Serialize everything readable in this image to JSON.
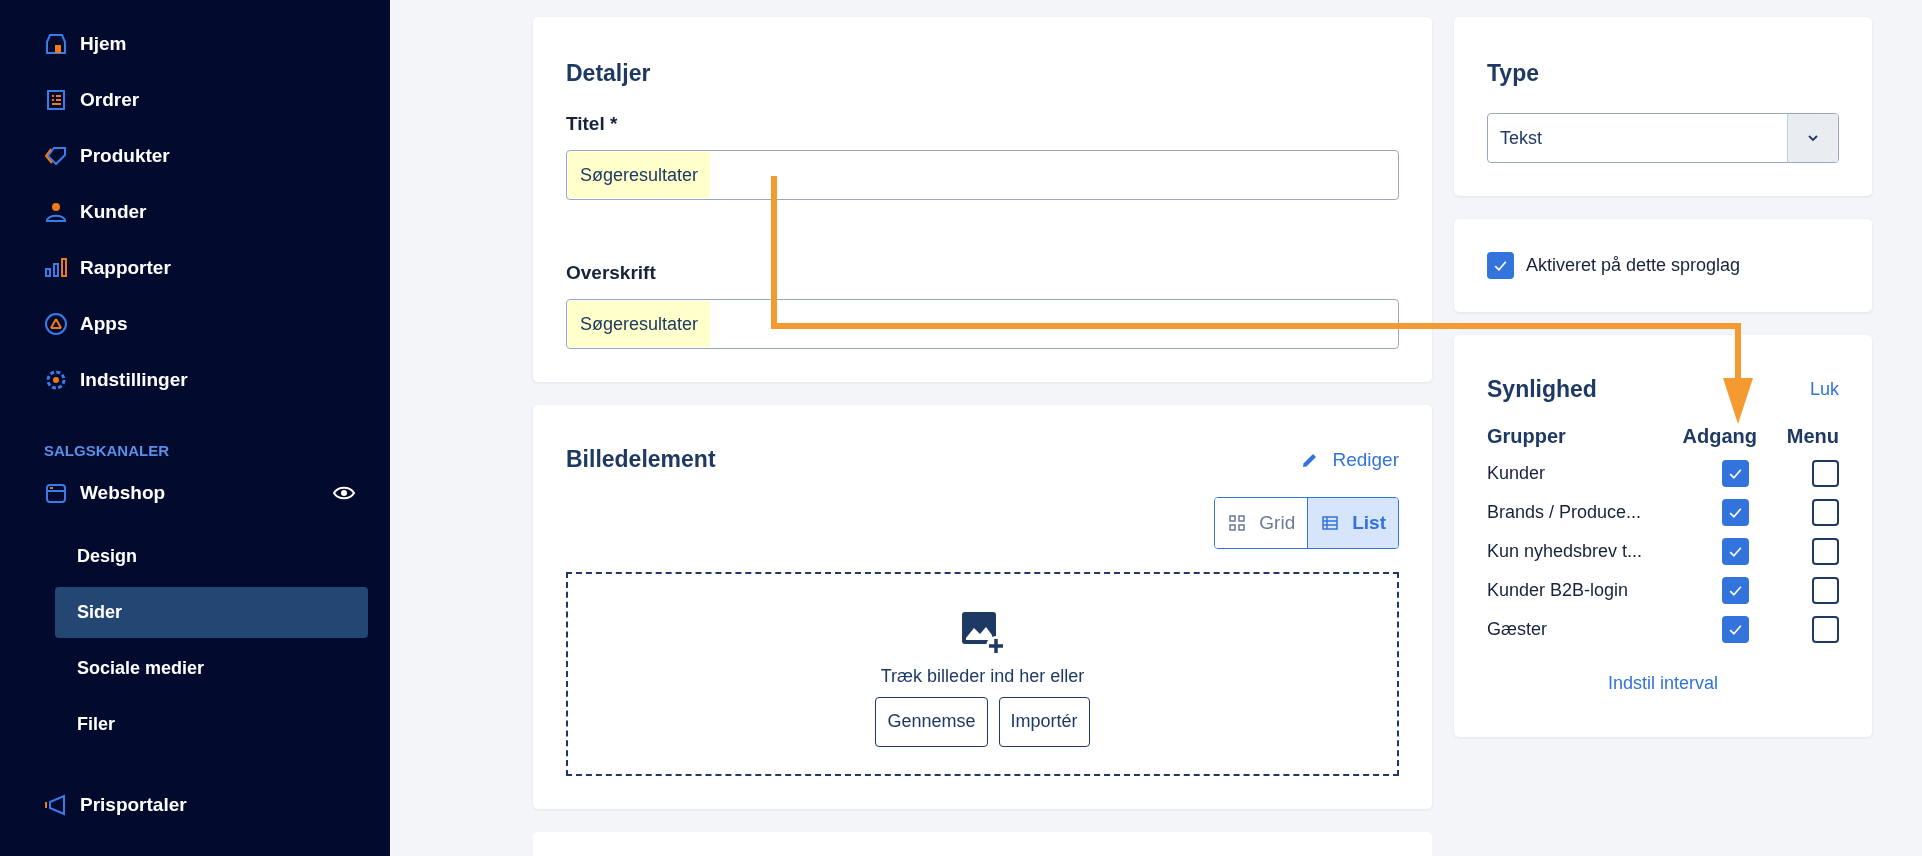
{
  "sidebar": {
    "nav": [
      {
        "label": "Hjem",
        "selected": false
      },
      {
        "label": "Ordrer",
        "selected": false
      },
      {
        "label": "Produkter",
        "selected": false
      },
      {
        "label": "Kunder",
        "selected": false
      },
      {
        "label": "Rapporter",
        "selected": false
      },
      {
        "label": "Apps",
        "selected": false
      },
      {
        "label": "Indstillinger",
        "selected": false
      }
    ],
    "section_title": "SALGSKANALER",
    "channel": {
      "label": "Webshop"
    },
    "sub_items": [
      {
        "label": "Design",
        "selected": false
      },
      {
        "label": "Sider",
        "selected": true
      },
      {
        "label": "Sociale medier",
        "selected": false
      },
      {
        "label": "Filer",
        "selected": false
      }
    ],
    "bottom_items": [
      {
        "label": "Prisportaler",
        "selected": false
      }
    ]
  },
  "details": {
    "title": "Detaljer",
    "fields": [
      {
        "label": "Titel *",
        "value": "Søgeresultater",
        "highlighted": true
      },
      {
        "label": "Overskrift",
        "value": "Søgeresultater",
        "highlighted": true
      }
    ]
  },
  "image_element": {
    "title": "Billedelement",
    "edit_link": "Rediger",
    "view_toggle": [
      {
        "label": "Grid",
        "selected": false
      },
      {
        "label": "List",
        "selected": true
      }
    ],
    "dropzone": {
      "text": "Træk billeder ind her eller",
      "buttons": [
        "Gennemse",
        "Importér"
      ]
    }
  },
  "type_card": {
    "title": "Type",
    "select_value": "Tekst"
  },
  "language_toggle": {
    "label": "Aktiveret på dette sproglag",
    "checked": true
  },
  "visibility": {
    "title": "Synlighed",
    "close_link": "Luk",
    "columns": [
      "Grupper",
      "Adgang",
      "Menu"
    ],
    "rows": [
      {
        "name": "Kunder",
        "access": true,
        "menu": false
      },
      {
        "name": "Brands / Produce...",
        "access": true,
        "menu": false
      },
      {
        "name": "Kun nyhedsbrev t...",
        "access": true,
        "menu": false
      },
      {
        "name": "Kunder B2B-login",
        "access": true,
        "menu": false
      },
      {
        "name": "Gæster",
        "access": true,
        "menu": false
      }
    ],
    "link": "Indstil interval"
  }
}
